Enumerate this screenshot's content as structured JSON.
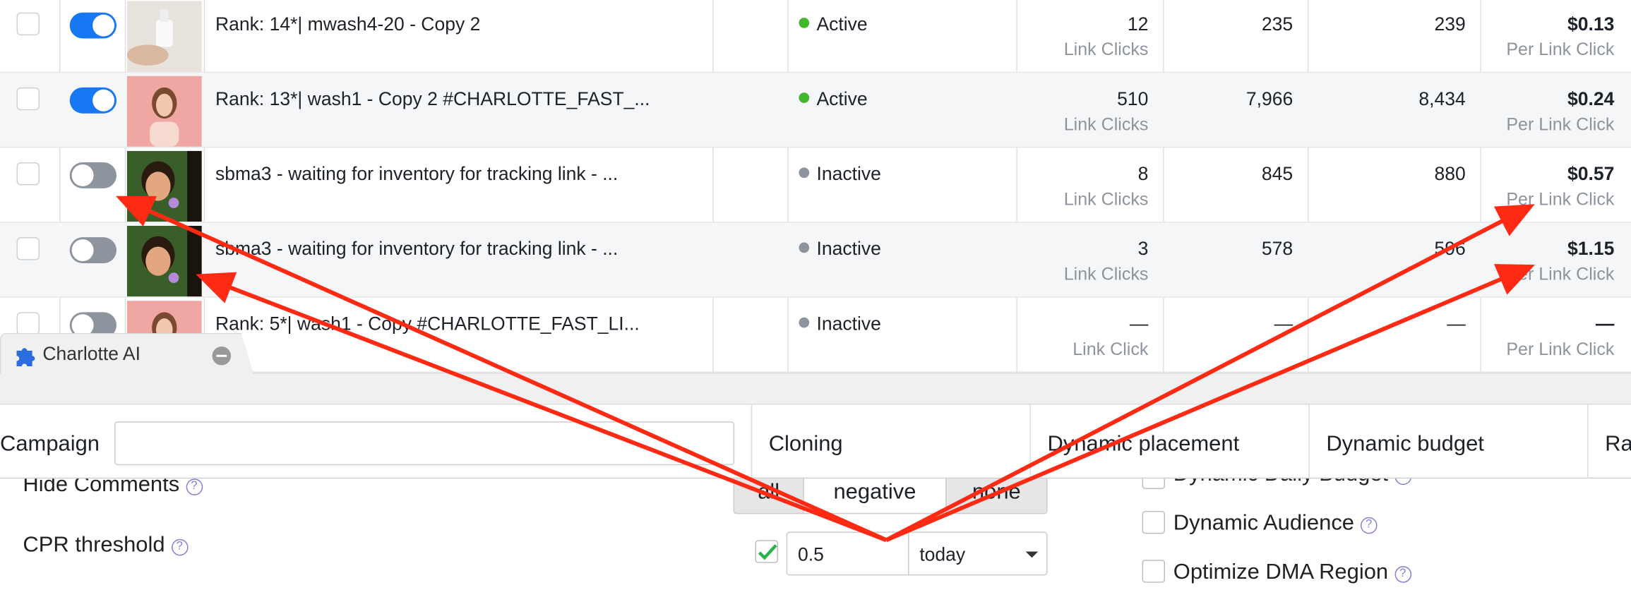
{
  "rows": [
    {
      "name": "Rank: 14*| mwash4-20 - Copy 2",
      "status": "Active",
      "results": "12",
      "results_unit": "Link Clicks",
      "reach": "235",
      "impressions": "239",
      "cost": "$0.13",
      "cost_unit": "Per Link Click",
      "toggle_on": true,
      "thumb": "bottle"
    },
    {
      "name": "Rank: 13*| wash1 - Copy 2 #CHARLOTTE_FAST_...",
      "status": "Active",
      "results": "510",
      "results_unit": "Link Clicks",
      "reach": "7,966",
      "impressions": "8,434",
      "cost": "$0.24",
      "cost_unit": "Per Link Click",
      "toggle_on": true,
      "thumb": "woman"
    },
    {
      "name": "sbma3 - waiting for inventory for tracking link - ...",
      "status": "Inactive",
      "results": "8",
      "results_unit": "Link Clicks",
      "reach": "845",
      "impressions": "880",
      "cost": "$0.57",
      "cost_unit": "Per Link Click",
      "toggle_on": false,
      "thumb": "child"
    },
    {
      "name": "sbma3 - waiting for inventory for tracking link - ...",
      "status": "Inactive",
      "results": "3",
      "results_unit": "Link Clicks",
      "reach": "578",
      "impressions": "596",
      "cost": "$1.15",
      "cost_unit": "Per Link Click",
      "toggle_on": false,
      "thumb": "child"
    },
    {
      "name": "Rank: 5*| wash1 - Copy #CHARLOTTE_FAST_LI...",
      "status": "Inactive",
      "results": "—",
      "results_unit": "Link Click",
      "reach": "—",
      "impressions": "—",
      "cost": "—",
      "cost_unit": "Per Link Click",
      "toggle_on": false,
      "thumb": "woman"
    }
  ],
  "colors": {
    "active": "#42b72a",
    "inactive": "#8d949e",
    "toggle_on": "#1877f2",
    "toggle_off": "#8d949e",
    "annotation": "#ff2a14"
  },
  "panel": {
    "tab_title": "Charlotte AI",
    "tab_icon": "puzzle-icon",
    "columns": {
      "campaign": "Campaign",
      "cloning": "Cloning",
      "dynamic_placement": "Dynamic placement",
      "dynamic_budget": "Dynamic budget",
      "rank": "Ra"
    },
    "campaign_value": "",
    "hide_comments": "Hide Comments",
    "comment_options": [
      "all",
      "negative",
      "none"
    ],
    "cpr_threshold": "CPR threshold",
    "cpr_value": "0.5",
    "cpr_period": "today",
    "cpr_checked": true,
    "dynamic_daily_budget": "Dynamic Daily Budget",
    "dynamic_audience": "Dynamic Audience",
    "optimize_dma": "Optimize DMA Region"
  }
}
